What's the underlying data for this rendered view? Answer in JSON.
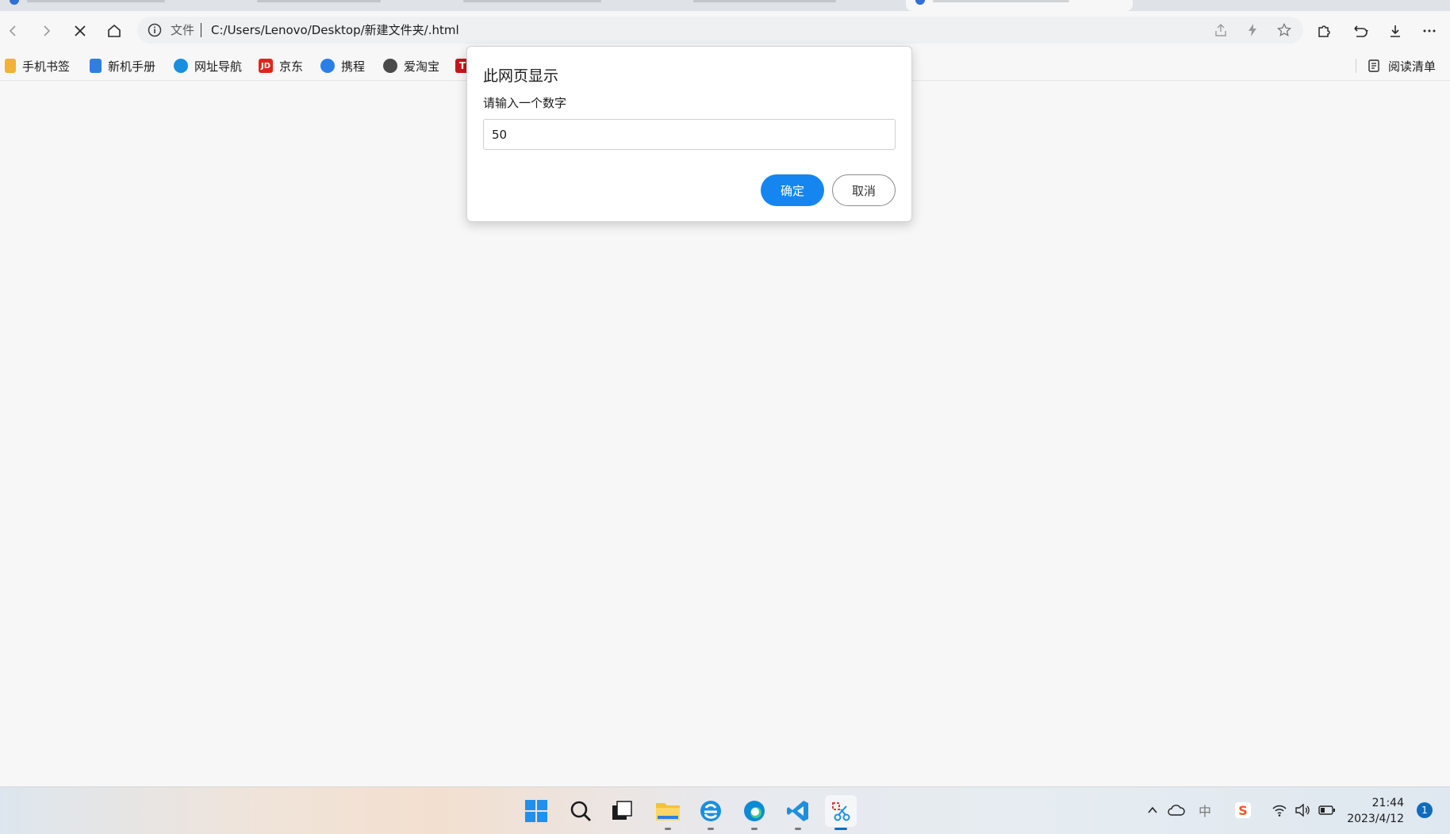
{
  "browser": {
    "address": {
      "scheme_label": "文件",
      "url": "C:/Users/Lenovo/Desktop/新建文件夹/.html"
    },
    "favorites": [
      {
        "label": "手机书签",
        "icon": "bookmark-phone-icon",
        "color": "#3b7de0"
      },
      {
        "label": "新机手册",
        "icon": "manual-icon",
        "color": "#2f7fe0"
      },
      {
        "label": "网址导航",
        "icon": "ie-nav-icon",
        "color": "#1a8fe0"
      },
      {
        "label": "京东",
        "icon": "jd-icon",
        "color": "#e1251b"
      },
      {
        "label": "携程",
        "icon": "ctrip-icon",
        "color": "#2b7ee8"
      },
      {
        "label": "爱淘宝",
        "icon": "aitaobao-icon",
        "color": "#4a4a4a"
      }
    ],
    "reading_list_label": "阅读清单"
  },
  "dialog": {
    "title": "此网页显示",
    "message": "请输入一个数字",
    "input_value": "50",
    "ok_label": "确定",
    "cancel_label": "取消",
    "accent_color": "#1586f0"
  },
  "taskbar": {
    "time": "21:44",
    "date": "2023/4/12",
    "notification_count": "1",
    "ime_label": "中"
  }
}
